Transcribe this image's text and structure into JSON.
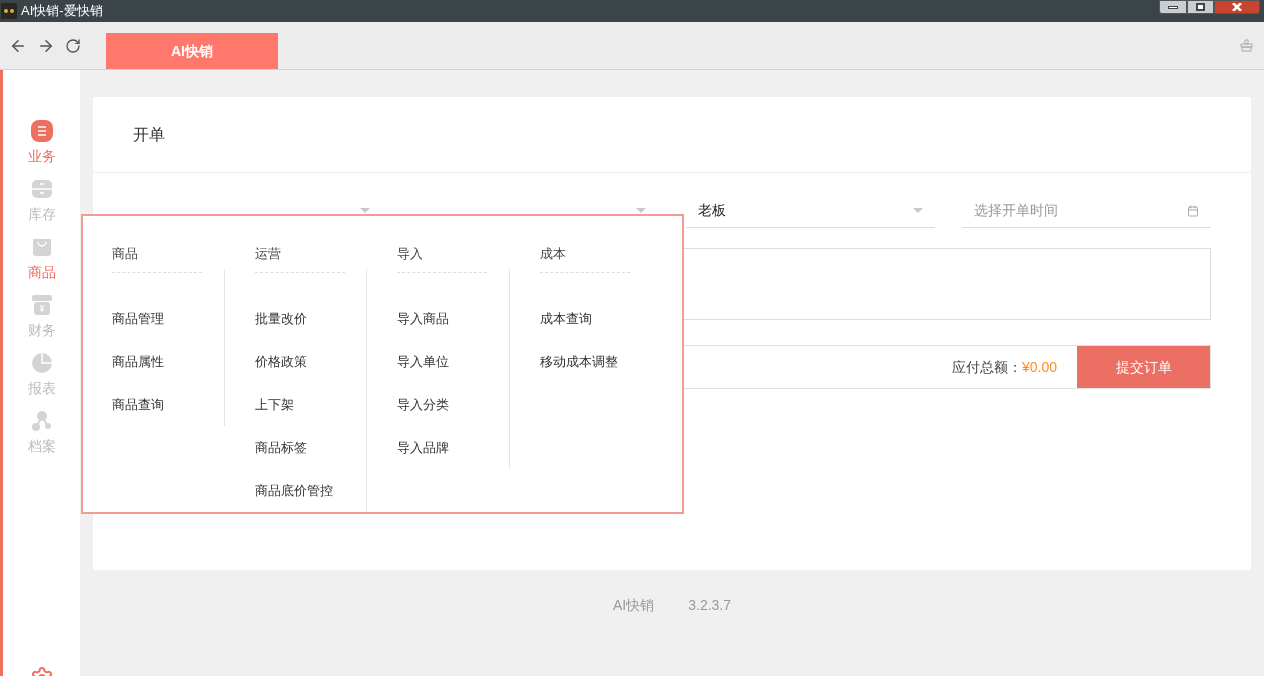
{
  "window": {
    "title": "AI快销-爱快销"
  },
  "tabs": [
    {
      "label": "AI快销",
      "selected": true
    }
  ],
  "sidebar": {
    "items": [
      {
        "label": "业务",
        "kind": "list",
        "selected": true,
        "menu_open": false
      },
      {
        "label": "库存",
        "kind": "drawer",
        "selected": false,
        "menu_open": false
      },
      {
        "label": "商品",
        "kind": "bag",
        "selected": false,
        "menu_open": true
      },
      {
        "label": "财务",
        "kind": "money",
        "selected": false,
        "menu_open": false
      },
      {
        "label": "报表",
        "kind": "pie",
        "selected": false,
        "menu_open": false
      },
      {
        "label": "档案",
        "kind": "share",
        "selected": false,
        "menu_open": false
      }
    ]
  },
  "page": {
    "title": "开单",
    "fields": [
      {
        "kind": "select"
      },
      {
        "kind": "select"
      },
      {
        "value": "老板",
        "kind": "select"
      },
      {
        "placeholder": "选择开单时间",
        "kind": "date"
      }
    ],
    "total_label": "应付总额：",
    "total_value": "¥0.00",
    "submit": "提交订单"
  },
  "menu": {
    "columns": [
      {
        "heading": "商品",
        "items": [
          "商品管理",
          "商品属性",
          "商品查询"
        ]
      },
      {
        "heading": "运营",
        "items": [
          "批量改价",
          "价格政策",
          "上下架",
          "商品标签",
          "商品底价管控"
        ]
      },
      {
        "heading": "导入",
        "items": [
          "导入商品",
          "导入单位",
          "导入分类",
          "导入品牌"
        ]
      },
      {
        "heading": "成本",
        "items": [
          "成本查询",
          "移动成本调整"
        ]
      }
    ]
  },
  "footer": {
    "app": "AI快销",
    "version": "3.2.3.7"
  }
}
